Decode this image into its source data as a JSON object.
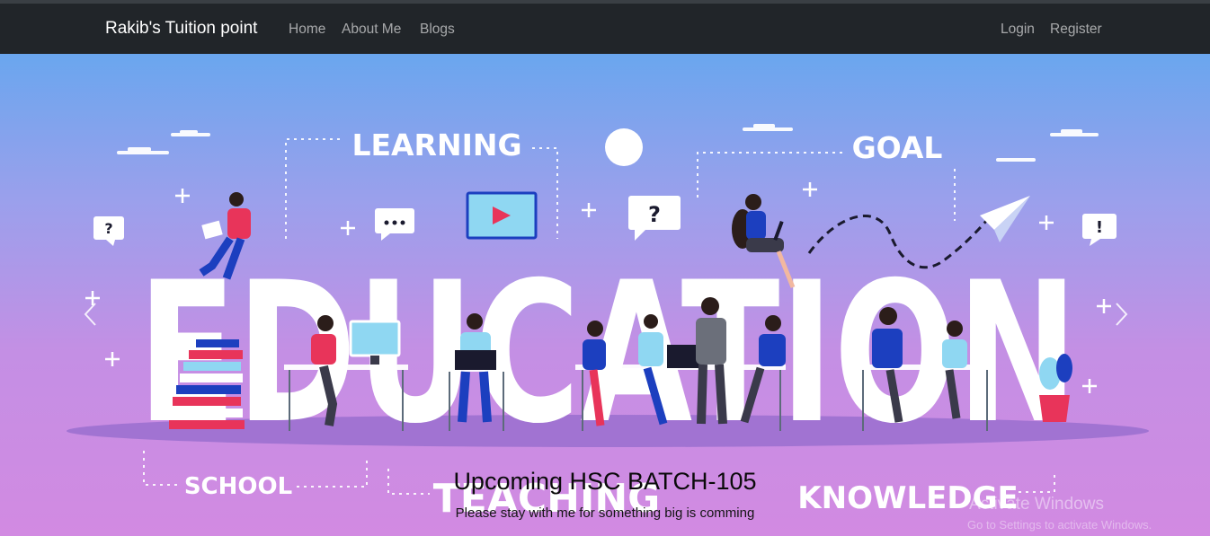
{
  "navbar": {
    "brand": "Rakib's Tuition point",
    "links": [
      "Home",
      "About Me",
      "Blogs"
    ],
    "auth": [
      "Login",
      "Register"
    ]
  },
  "hero": {
    "illustration_words": {
      "main": "EDUCATION",
      "learning": "LEARNING",
      "goal": "GOAL",
      "school": "SCHOOL",
      "teaching": "TEACHING",
      "knowledge": "KNOWLEDGE"
    },
    "caption_title": "Upcoming HSC BATCH-105",
    "caption_text": "Please stay with me for something big is comming",
    "controls": {
      "prev_icon": "chevron-left-icon",
      "next_icon": "chevron-right-icon"
    }
  },
  "overlay": {
    "activate_title": "Activate Windows",
    "activate_text": "Go to Settings to activate Windows."
  }
}
